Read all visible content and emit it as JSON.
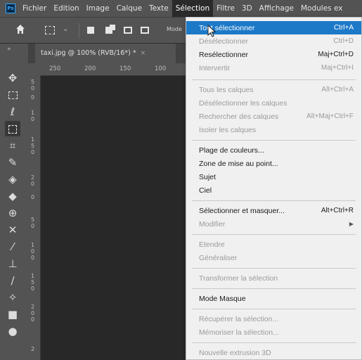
{
  "menubar": {
    "logo": "Ps",
    "items": [
      "Fichier",
      "Edition",
      "Image",
      "Calque",
      "Texte",
      "Sélection",
      "Filtre",
      "3D",
      "Affichage",
      "Modules ex"
    ],
    "active_index": 5
  },
  "options": {
    "mode_label": "Mode"
  },
  "tab": {
    "title": "taxi.jpg @ 100% (RVB/16*) *",
    "close": "×"
  },
  "ruler": {
    "top_ticks": [
      "250",
      "200",
      "150",
      "100"
    ],
    "left_ticks": [
      "5\n0",
      "0",
      "1\n0",
      "1\n5\n0",
      "2\n0",
      "0",
      "5\n0",
      "1\n0\n0",
      "1\n5\n0",
      "2\n0\n0",
      "2"
    ]
  },
  "dropdown": {
    "items": [
      {
        "label": "Tout sélectionner",
        "shortcut": "Ctrl+A",
        "highlight": true,
        "disabled": false
      },
      {
        "label": "Désélectionner",
        "shortcut": "Ctrl+D",
        "disabled": true
      },
      {
        "label": "Resélectionner",
        "shortcut": "Maj+Ctrl+D",
        "disabled": false
      },
      {
        "label": "Intervertir",
        "shortcut": "Maj+Ctrl+I",
        "disabled": true
      },
      {
        "label": "Tous les calques",
        "shortcut": "Alt+Ctrl+A",
        "disabled": true
      },
      {
        "label": "Désélectionner les calques",
        "shortcut": "",
        "disabled": true
      },
      {
        "label": "Rechercher des calques",
        "shortcut": "Alt+Maj+Ctrl+F",
        "disabled": true
      },
      {
        "label": "Isoler les calques",
        "shortcut": "",
        "disabled": true
      },
      {
        "label": "Plage de couleurs...",
        "shortcut": "",
        "disabled": false
      },
      {
        "label": "Zone de mise au point...",
        "shortcut": "",
        "disabled": false
      },
      {
        "label": "Sujet",
        "shortcut": "",
        "disabled": false
      },
      {
        "label": "Ciel",
        "shortcut": "",
        "disabled": false
      },
      {
        "label": "Sélectionner et masquer...",
        "shortcut": "Alt+Ctrl+R",
        "disabled": false
      },
      {
        "label": "Modifier",
        "shortcut": "",
        "disabled": true,
        "submenu": true
      },
      {
        "label": "Etendre",
        "shortcut": "",
        "disabled": true
      },
      {
        "label": "Généraliser",
        "shortcut": "",
        "disabled": true
      },
      {
        "label": "Transformer la sélection",
        "shortcut": "",
        "disabled": true
      },
      {
        "label": "Mode Masque",
        "shortcut": "",
        "disabled": false
      },
      {
        "label": "Récupérer la sélection...",
        "shortcut": "",
        "disabled": true
      },
      {
        "label": "Mémoriser la sélection...",
        "shortcut": "",
        "disabled": true
      },
      {
        "label": "Nouvelle extrusion 3D",
        "shortcut": "",
        "disabled": true
      }
    ]
  },
  "colors": {
    "menu_bg": "#535353",
    "highlight": "#1c79c8",
    "dropdown_bg": "#f0f0f0",
    "canvas_bg": "#282828"
  }
}
